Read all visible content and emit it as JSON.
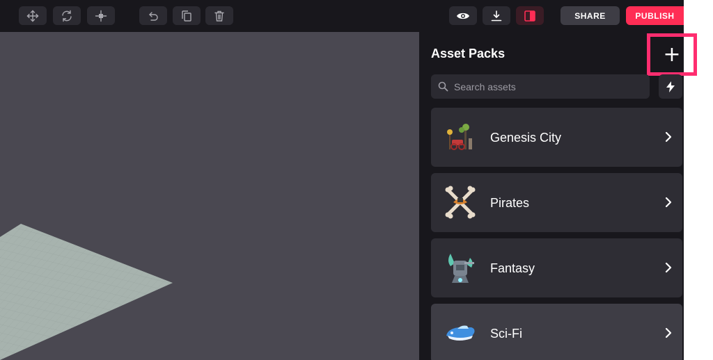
{
  "toolbar": {
    "left_tools": [
      {
        "icon": "move-icon"
      },
      {
        "icon": "rotate-icon"
      },
      {
        "icon": "scale-icon"
      },
      {
        "icon": "undo-icon"
      },
      {
        "icon": "duplicate-icon"
      },
      {
        "icon": "delete-icon"
      }
    ],
    "right_tools": [
      {
        "icon": "eye-icon"
      },
      {
        "icon": "download-icon"
      },
      {
        "icon": "panel-toggle-icon"
      }
    ],
    "share_label": "SHARE",
    "publish_label": "PUBLISH"
  },
  "panel": {
    "title": "Asset Packs",
    "add_label": "+",
    "search_placeholder": "Search assets",
    "packs": [
      {
        "name": "Genesis City",
        "icon": "genesis-city-thumbnail"
      },
      {
        "name": "Pirates",
        "icon": "pirates-thumbnail"
      },
      {
        "name": "Fantasy",
        "icon": "fantasy-thumbnail"
      },
      {
        "name": "Sci-Fi",
        "icon": "sci-fi-thumbnail"
      }
    ]
  },
  "colors": {
    "background": "#18171c",
    "viewport": "#4a4851",
    "card": "#2e2d34",
    "publish": "#ff2d55",
    "highlight": "#ff2d6f"
  }
}
